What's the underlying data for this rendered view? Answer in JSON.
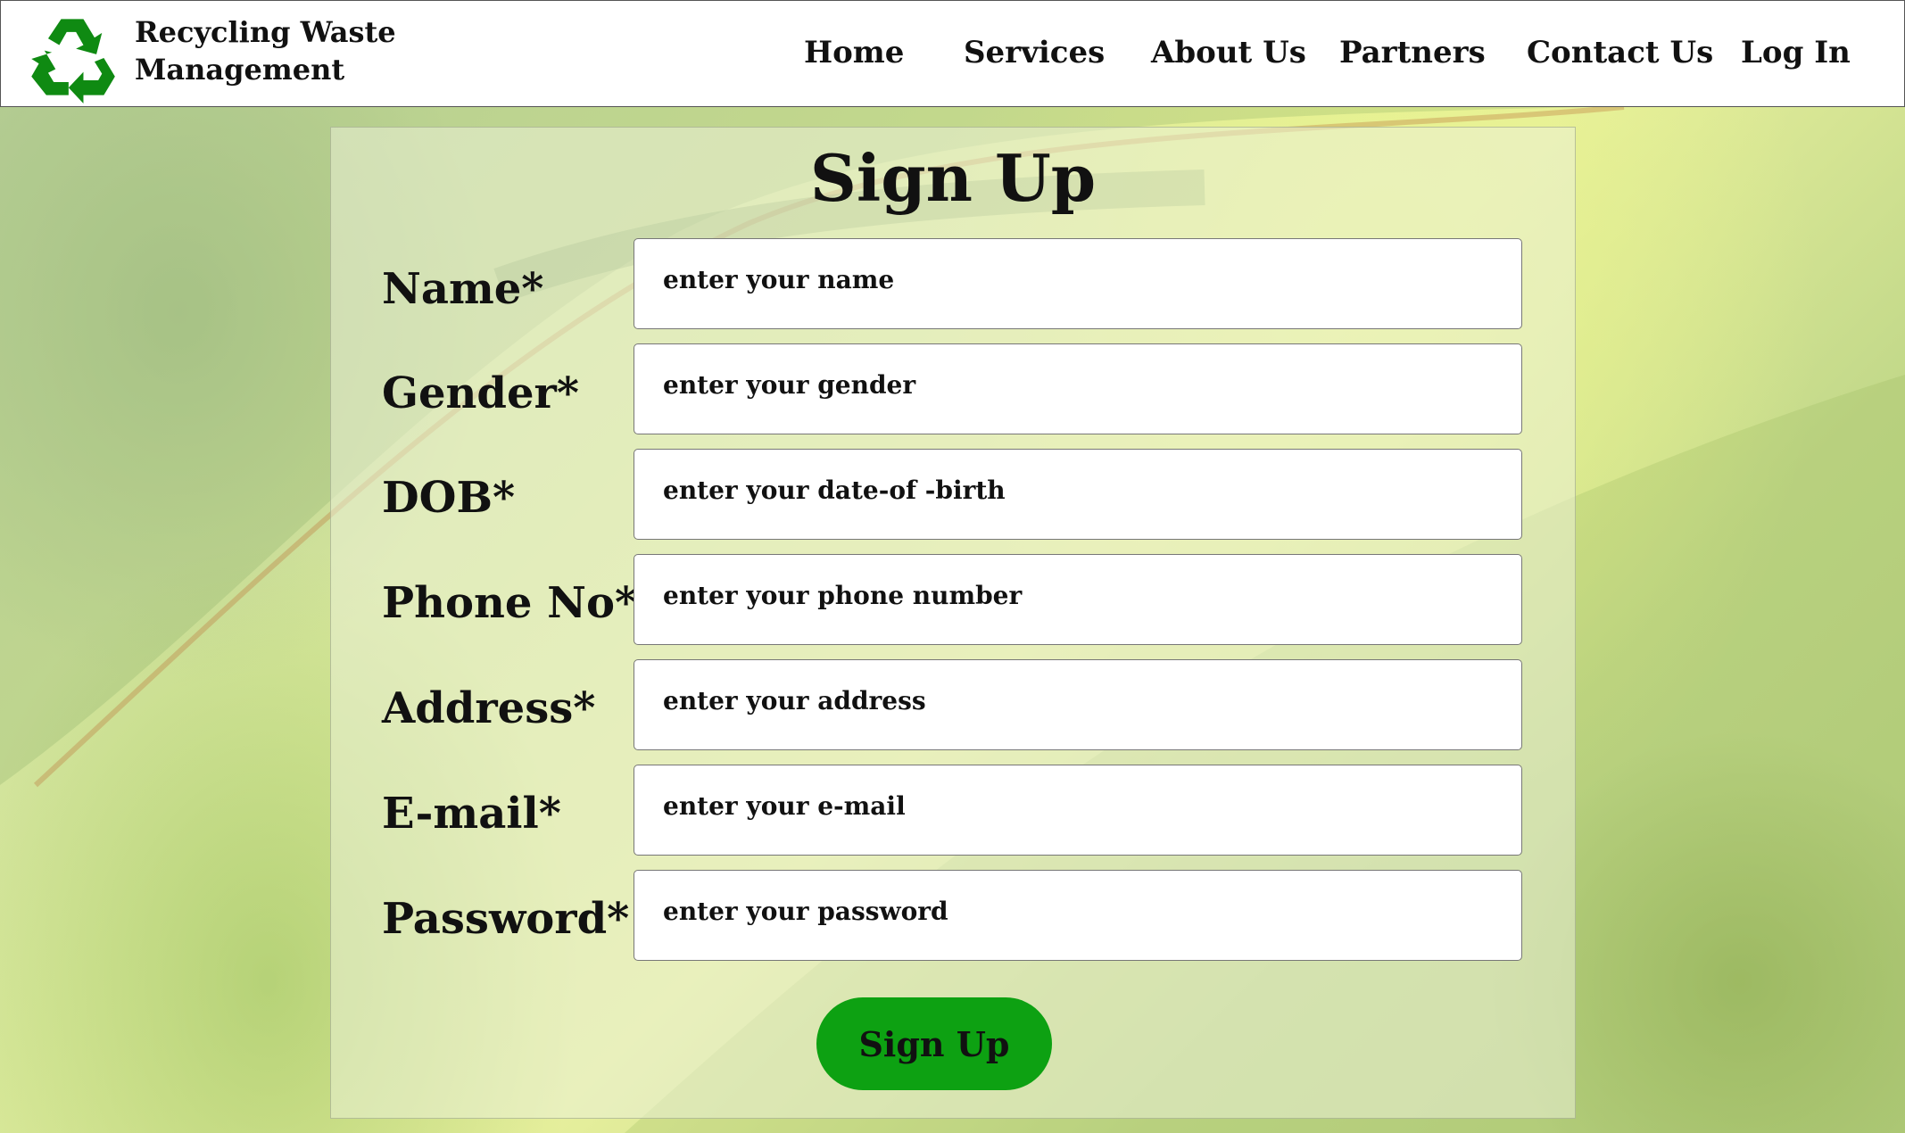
{
  "brand": {
    "line1": "Recycling Waste",
    "line2": "Management",
    "logo_icon": "recycle-icon",
    "logo_color": "#0f8a12"
  },
  "nav": {
    "home": "Home",
    "services": "Services",
    "about": "About Us",
    "partners": "Partners",
    "contact": "Contact Us",
    "login": "Log In"
  },
  "form": {
    "title": "Sign Up",
    "fields": [
      {
        "label": "Name*",
        "placeholder": "enter your name",
        "value": ""
      },
      {
        "label": "Gender*",
        "placeholder": "enter your gender",
        "value": ""
      },
      {
        "label": "DOB*",
        "placeholder": "enter your date-of -birth",
        "value": ""
      },
      {
        "label": "Phone No*",
        "placeholder": "enter your phone number",
        "value": ""
      },
      {
        "label": "Address*",
        "placeholder": "enter your address",
        "value": ""
      },
      {
        "label": "E-mail*",
        "placeholder": "enter your e-mail",
        "value": ""
      },
      {
        "label": "Password*",
        "placeholder": "enter your password",
        "value": ""
      }
    ],
    "submit_label": "Sign Up",
    "submit_color": "#0da112"
  }
}
